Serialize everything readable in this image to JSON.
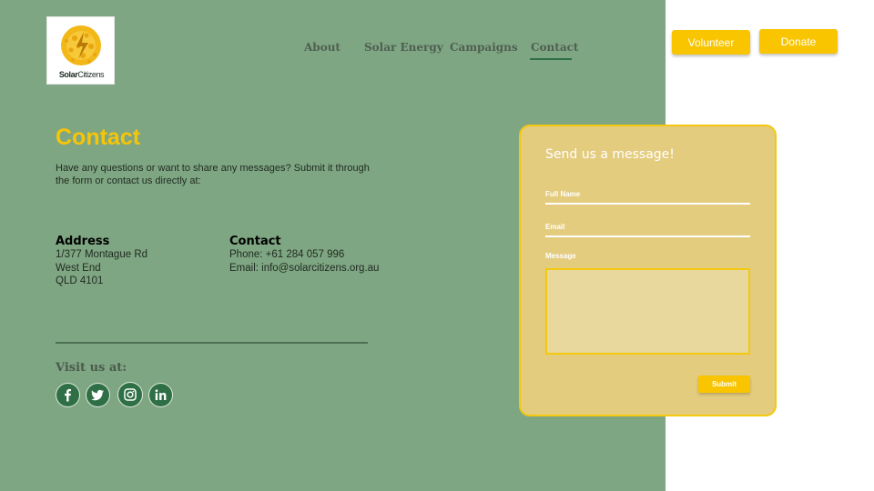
{
  "brand": {
    "logo_strong": "Solar",
    "logo_rest": "Citizens",
    "logo_icon": "sun-logo-icon"
  },
  "nav": {
    "items": [
      {
        "label": "About"
      },
      {
        "label": "Solar Energy"
      },
      {
        "label": "Campaigns"
      },
      {
        "label": "Contact",
        "active": true
      }
    ]
  },
  "header_buttons": {
    "volunteer": "Volunteer",
    "donate": "Donate"
  },
  "main": {
    "title": "Contact",
    "intro": "Have any questions or want to share any messages? Submit it through the form or contact us directly at:",
    "address": {
      "heading": "Address",
      "lines": [
        "1/377 Montague Rd",
        "West End",
        "QLD 4101"
      ]
    },
    "contact": {
      "heading": "Contact",
      "phone": "Phone: +61 284 057 996",
      "email": "Email:  info@solarcitizens.org.au"
    },
    "visit_label": "Visit us at:",
    "social": [
      "facebook-icon",
      "twitter-icon",
      "instagram-icon",
      "linkedin-icon"
    ]
  },
  "form": {
    "title": "Send us a message!",
    "full_name_label": "Full Name",
    "email_label": "Email",
    "message_label": "Message",
    "submit_label": "Submit"
  },
  "colors": {
    "panel_green": "#7fa682",
    "accent_yellow": "#f7c508",
    "card_yellow": "#e4cc7f",
    "social_green": "#2f6f45"
  }
}
